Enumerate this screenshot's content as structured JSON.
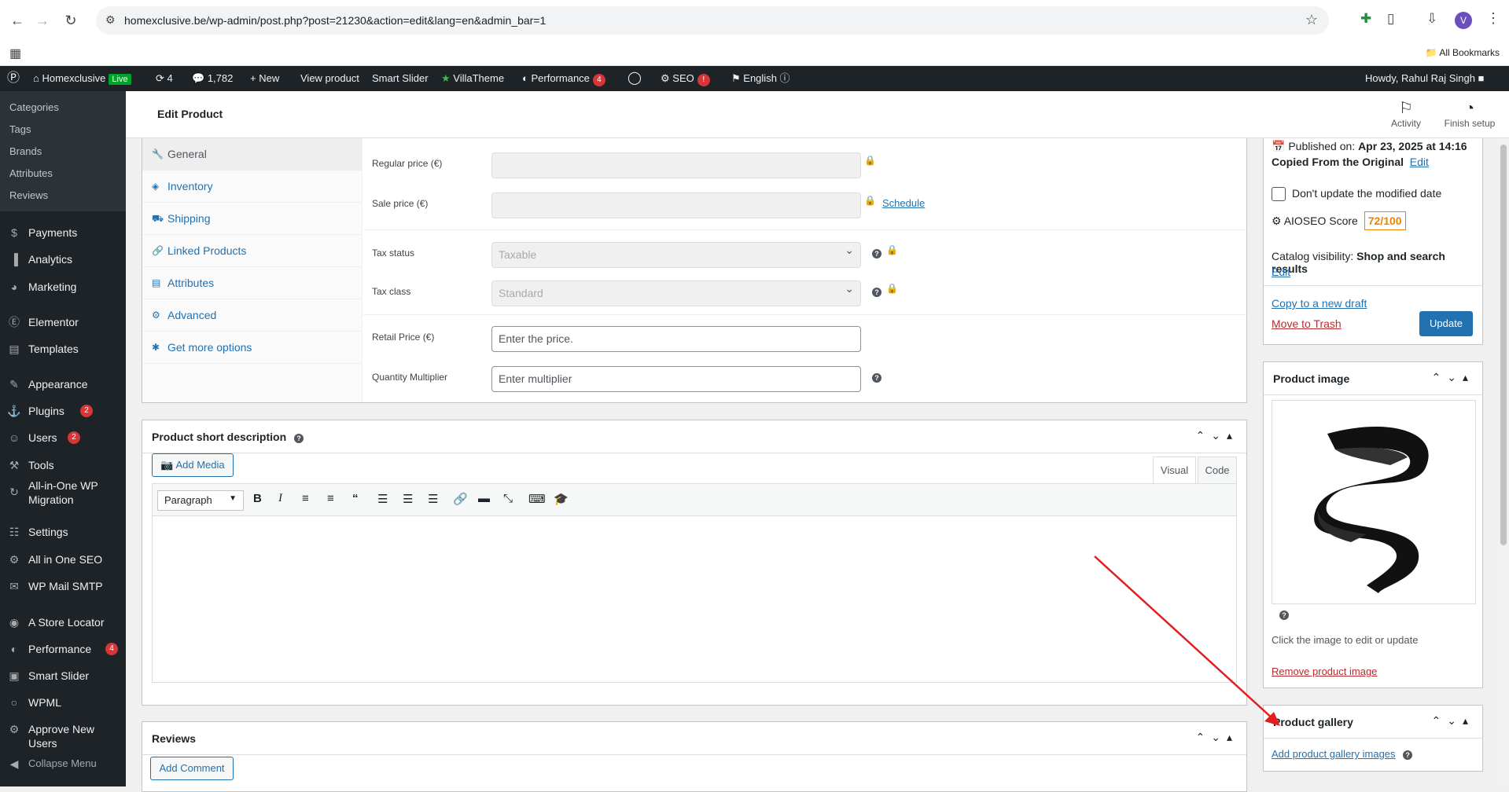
{
  "browser": {
    "url": "homexclusive.be/wp-admin/post.php?post=21230&action=edit&lang=en&admin_bar=1",
    "avatar": "V",
    "all_bookmarks": "All Bookmarks"
  },
  "adminbar": {
    "site": "Homexclusive",
    "live": "Live",
    "updates": "4",
    "comments": "1,782",
    "new": "New",
    "view_product": "View product",
    "smart_slider": "Smart Slider",
    "villatheme": "VillaTheme",
    "performance": "Performance",
    "performance_count": "4",
    "seo": "SEO",
    "seo_badge": "!",
    "language": "English",
    "howdy": "Howdy, Rahul Raj Singh"
  },
  "sidebar": {
    "sub": [
      "Categories",
      "Tags",
      "Brands",
      "Attributes",
      "Reviews"
    ],
    "items": [
      {
        "label": "Payments",
        "icon": "payments-icon"
      },
      {
        "label": "Analytics",
        "icon": "analytics-icon"
      },
      {
        "label": "Marketing",
        "icon": "marketing-icon"
      },
      {
        "label": "Elementor",
        "icon": "elementor-icon"
      },
      {
        "label": "Templates",
        "icon": "templates-icon"
      },
      {
        "label": "Appearance",
        "icon": "appearance-icon"
      },
      {
        "label": "Plugins",
        "icon": "plugins-icon",
        "badge": "2"
      },
      {
        "label": "Users",
        "icon": "users-icon",
        "badge": "2"
      },
      {
        "label": "Tools",
        "icon": "tools-icon"
      },
      {
        "label": "All-in-One WP Migration",
        "icon": "migration-icon"
      },
      {
        "label": "Settings",
        "icon": "settings-icon"
      },
      {
        "label": "All in One SEO",
        "icon": "aioseo-icon"
      },
      {
        "label": "WP Mail SMTP",
        "icon": "mail-icon"
      },
      {
        "label": "A Store Locator",
        "icon": "locator-icon"
      },
      {
        "label": "Performance",
        "icon": "performance-icon",
        "badge": "4"
      },
      {
        "label": "Smart Slider",
        "icon": "slider-icon"
      },
      {
        "label": "WPML",
        "icon": "wpml-icon"
      },
      {
        "label": "Approve New Users",
        "icon": "approve-icon"
      },
      {
        "label": "Collapse Menu",
        "icon": "collapse-icon"
      }
    ]
  },
  "topbar": {
    "title": "Edit Product",
    "activity": "Activity",
    "finish_setup": "Finish setup"
  },
  "product_data": {
    "tabs": [
      "General",
      "Inventory",
      "Shipping",
      "Linked Products",
      "Attributes",
      "Advanced",
      "Get more options"
    ],
    "regular_price_label": "Regular price (€)",
    "sale_price_label": "Sale price (€)",
    "schedule": "Schedule",
    "tax_status_label": "Tax status",
    "tax_status_value": "Taxable",
    "tax_class_label": "Tax class",
    "tax_class_value": "Standard",
    "retail_price_label": "Retail Price (€)",
    "retail_price_placeholder": "Enter the price.",
    "qty_mult_label": "Quantity Multiplier",
    "qty_mult_placeholder": "Enter multiplier"
  },
  "short_desc": {
    "title": "Product short description",
    "add_media": "Add Media",
    "visual": "Visual",
    "code": "Code",
    "format": "Paragraph"
  },
  "reviews": {
    "title": "Reviews",
    "add_comment": "Add Comment"
  },
  "publish": {
    "published_label": "Published on: ",
    "published_date": "Apr 23, 2025 at 14:16",
    "copied": "Copied From the Original",
    "edit": "Edit",
    "dont_update": "Don't update the modified date",
    "aioseo_label": "AIOSEO Score",
    "aioseo_score": "72/100",
    "catalog_label": "Catalog visibility: ",
    "catalog_value": "Shop and search results",
    "catalog_edit": "Edit",
    "copy_draft": "Copy to a new draft",
    "trash": "Move to Trash",
    "update": "Update"
  },
  "product_image": {
    "title": "Product image",
    "hint": "Click the image to edit or update",
    "remove": "Remove product image"
  },
  "gallery": {
    "title": "Product gallery",
    "add": "Add product gallery images"
  }
}
